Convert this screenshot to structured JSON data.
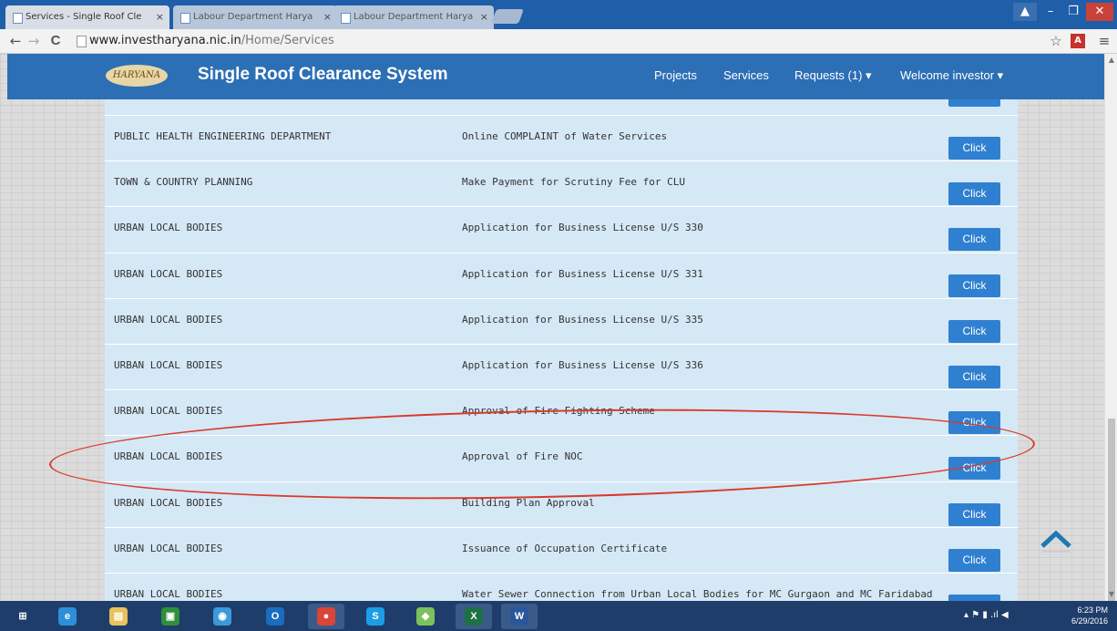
{
  "browser": {
    "tabs": [
      {
        "title": "Services - Single Roof Cle",
        "active": true
      },
      {
        "title": "Labour Department Harya",
        "active": false
      },
      {
        "title": "Labour Department Harya",
        "active": false
      }
    ],
    "tab_close": "×",
    "url_host": "www.investharyana.nic.in",
    "url_path": "/Home/Services",
    "back_icon": "←",
    "forward_icon": "→",
    "reload_icon": "C",
    "star_icon": "☆",
    "menu_icon": "≡"
  },
  "window": {
    "user": "▲",
    "minimize": "–",
    "restore": "❐",
    "close": "✕"
  },
  "navbar": {
    "logo_text": "HARYANA",
    "brand": "Single Roof Clearance System",
    "links": [
      "Projects",
      "Services",
      "Requests (1) ▾",
      "Welcome investor ▾"
    ]
  },
  "table": {
    "button_label": "Click",
    "rows": [
      {
        "dept": "PUBLIC HEALTH ENGINEERING DEPARTMENT",
        "service": "Online COMPLAINT of Water Services"
      },
      {
        "dept": "TOWN & COUNTRY PLANNING",
        "service": "Make Payment for Scrutiny Fee for CLU"
      },
      {
        "dept": "URBAN LOCAL BODIES",
        "service": "Application for Business License U/S 330"
      },
      {
        "dept": "URBAN LOCAL BODIES",
        "service": "Application for Business License U/S 331"
      },
      {
        "dept": "URBAN LOCAL BODIES",
        "service": "Application for Business License U/S 335"
      },
      {
        "dept": "URBAN LOCAL BODIES",
        "service": "Application for Business License U/S 336"
      },
      {
        "dept": "URBAN LOCAL BODIES",
        "service": "Approval of Fire Fighting Scheme"
      },
      {
        "dept": "URBAN LOCAL BODIES",
        "service": "Approval of Fire NOC"
      },
      {
        "dept": "URBAN LOCAL BODIES",
        "service": "Building Plan Approval"
      },
      {
        "dept": "URBAN LOCAL BODIES",
        "service": "Issuance of Occupation Certificate"
      },
      {
        "dept": "URBAN LOCAL BODIES",
        "service": "Water Sewer Connection from Urban Local Bodies for MC Gurgaon and MC Faridabad"
      }
    ]
  },
  "taskbar": {
    "icons": [
      {
        "name": "windows-start-icon",
        "glyph": "⊞",
        "color": "#1f3d6a"
      },
      {
        "name": "internet-explorer-icon",
        "glyph": "e",
        "color": "#2b8fd9"
      },
      {
        "name": "file-explorer-icon",
        "glyph": "▤",
        "color": "#e8c25a"
      },
      {
        "name": "store-icon",
        "glyph": "▣",
        "color": "#2f8f3a"
      },
      {
        "name": "network-icon",
        "glyph": "◉",
        "color": "#3b9ad9"
      },
      {
        "name": "outlook-icon",
        "glyph": "O",
        "color": "#1a6cc0"
      },
      {
        "name": "chrome-icon",
        "glyph": "●",
        "color": "#db4437"
      },
      {
        "name": "skype-icon",
        "glyph": "S",
        "color": "#1c9ee6"
      },
      {
        "name": "folder-icon",
        "glyph": "◆",
        "color": "#7cc25c"
      },
      {
        "name": "excel-icon",
        "glyph": "X",
        "color": "#1e7145"
      },
      {
        "name": "word-icon",
        "glyph": "W",
        "color": "#2b579a"
      }
    ],
    "tray": "▴  ⚑  ▮ .ıl ◀",
    "time": "6:23 PM",
    "date": "6/29/2016"
  }
}
